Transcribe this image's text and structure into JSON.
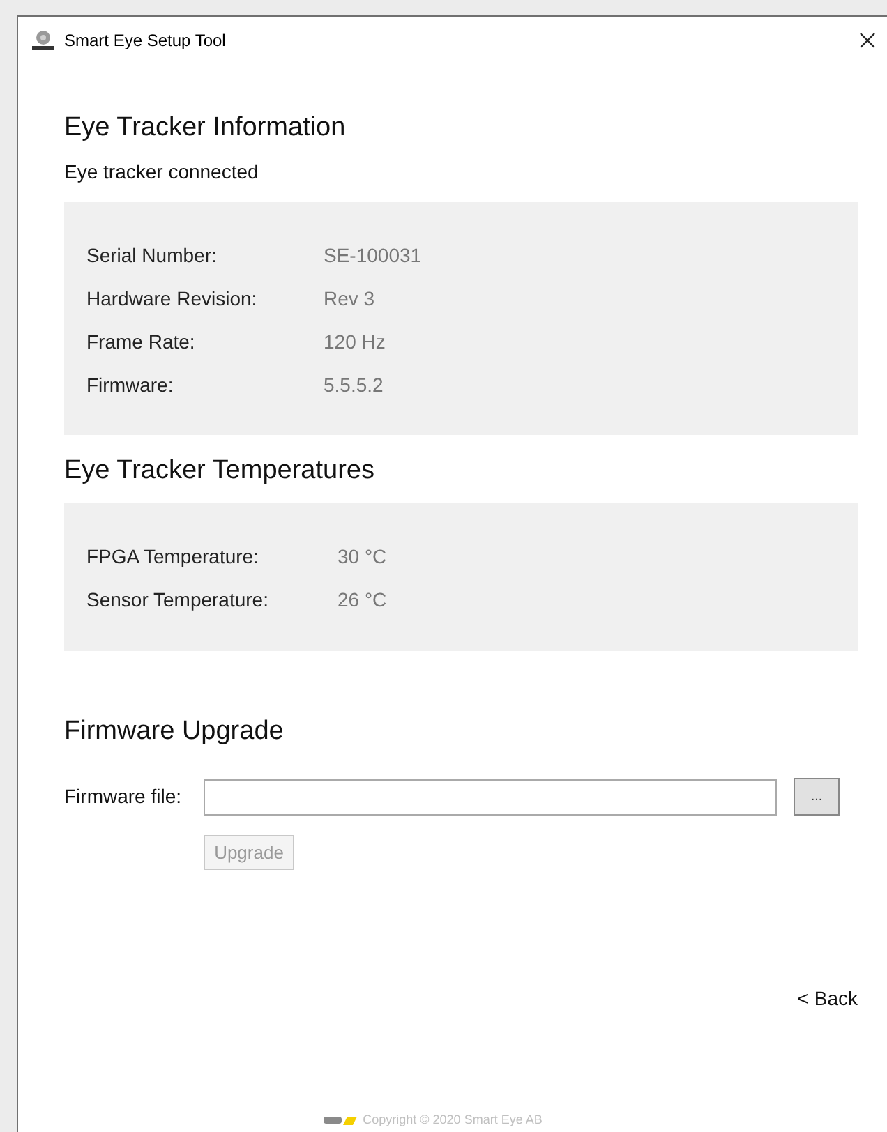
{
  "window": {
    "title": "Smart Eye Setup Tool"
  },
  "info": {
    "heading": "Eye Tracker Information",
    "status": "Eye tracker connected",
    "rows": [
      {
        "label": "Serial Number:",
        "value": "SE-100031"
      },
      {
        "label": "Hardware Revision:",
        "value": "Rev 3"
      },
      {
        "label": "Frame Rate:",
        "value": "120 Hz"
      },
      {
        "label": "Firmware:",
        "value": "5.5.5.2"
      }
    ]
  },
  "temperatures": {
    "heading": "Eye Tracker Temperatures",
    "rows": [
      {
        "label": "FPGA Temperature:",
        "value": "30 °C"
      },
      {
        "label": "Sensor Temperature:",
        "value": "26 °C"
      }
    ]
  },
  "upgrade": {
    "heading": "Firmware Upgrade",
    "file_label": "Firmware file:",
    "browse": "...",
    "button": {
      "label": "Upgrade",
      "disabled": true
    }
  },
  "back": "< Back",
  "footer": "Copyright © 2020 Smart Eye AB"
}
